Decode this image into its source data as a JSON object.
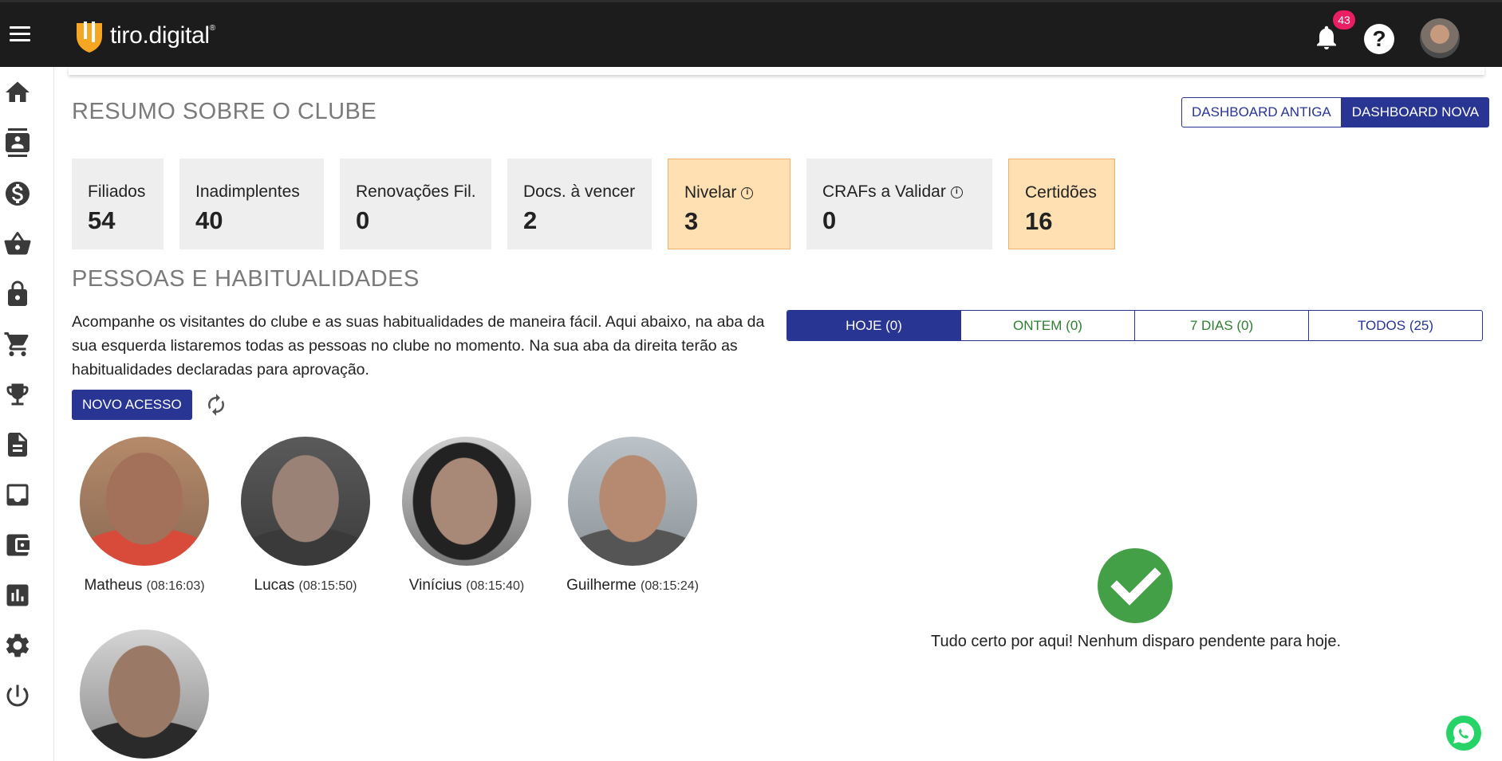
{
  "header": {
    "logo_text": "tiro.digital",
    "logo_reg": "®",
    "notification_count": "43",
    "help_label": "?"
  },
  "sidebar": {
    "items": [
      "home-icon",
      "contacts-icon",
      "dollar-icon",
      "basket-icon",
      "lock-icon",
      "cart-icon",
      "trophy-icon",
      "document-icon",
      "inbox-icon",
      "wallet-icon",
      "chart-icon",
      "gear-icon",
      "power-icon"
    ]
  },
  "summary": {
    "title": "RESUMO SOBRE O CLUBE",
    "dashboard_old": "DASHBOARD ANTIGA",
    "dashboard_new": "DASHBOARD NOVA",
    "stats": [
      {
        "label": "Filiados",
        "value": "54"
      },
      {
        "label": "Inadimplentes",
        "value": "40"
      },
      {
        "label": "Renovações Fil.",
        "value": "0"
      },
      {
        "label": "Docs. à vencer",
        "value": "2"
      },
      {
        "label": "Nivelar",
        "value": "3"
      },
      {
        "label": "CRAFs a Validar",
        "value": "0"
      },
      {
        "label": "Certidões",
        "value": "16"
      }
    ]
  },
  "people": {
    "title": "PESSOAS E HABITUALIDADES",
    "description": "Acompanhe os visitantes do clube e as suas habitualidades de maneira fácil. Aqui abaixo, na aba da sua esquerda listaremos todas as pessoas no clube no momento. Na sua aba da direita terão as habitualidades declaradas para aprovação.",
    "new_access_label": "NOVO ACESSO",
    "visitors": [
      {
        "name": "Matheus",
        "time": "(08:16:03)"
      },
      {
        "name": "Lucas",
        "time": "(08:15:50)"
      },
      {
        "name": "Vinícius",
        "time": "(08:15:40)"
      },
      {
        "name": "Guilherme",
        "time": "(08:15:24)"
      }
    ]
  },
  "habitualities": {
    "tabs": [
      "HOJE (0)",
      "ONTEM (0)",
      "7 DIAS (0)",
      "TODOS (25)"
    ],
    "empty_message": "Tudo certo por aqui! Nenhum disparo pendente para hoje."
  },
  "colors": {
    "primary": "#283593",
    "warning_bg": "#ffe0b2",
    "success": "#43a047",
    "topbar": "#1c1c1c"
  }
}
